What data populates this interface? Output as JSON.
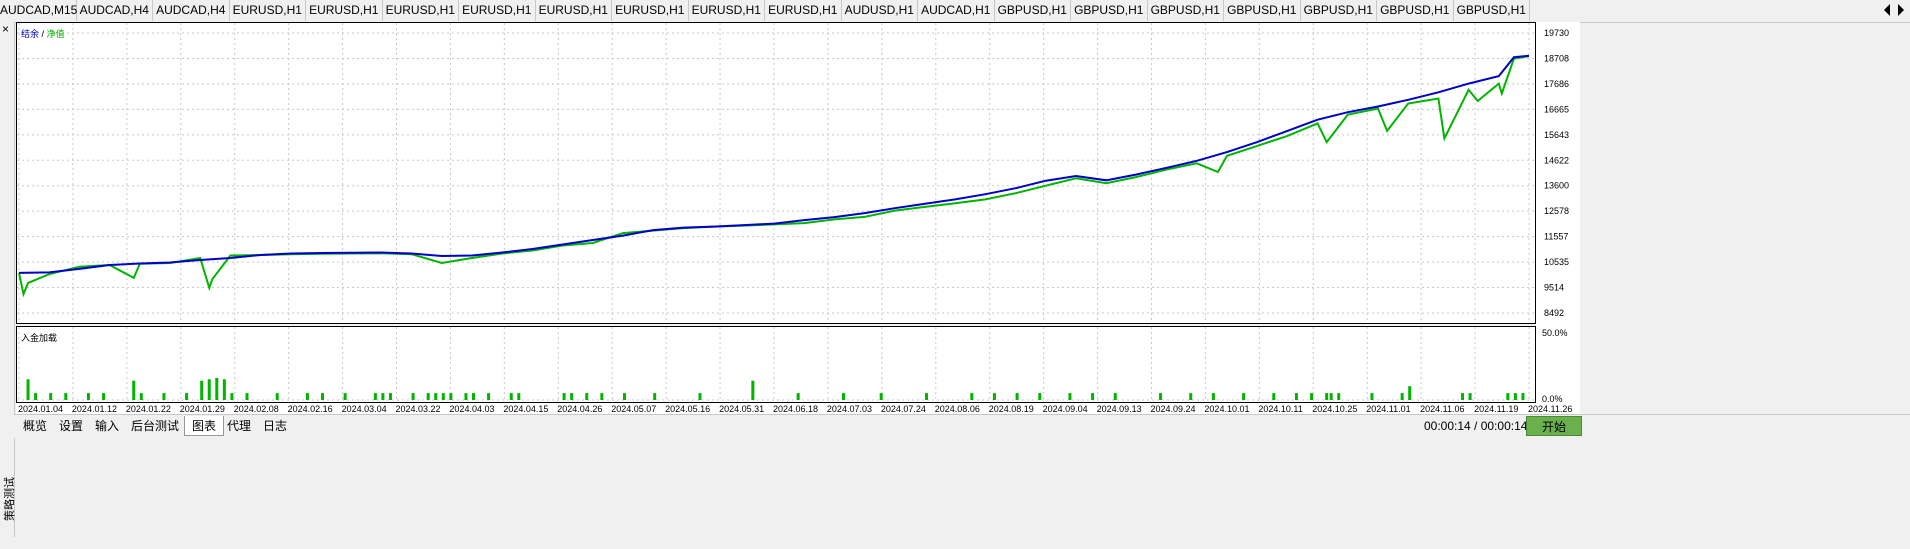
{
  "symbol_tabs": [
    "AUDCAD,M15",
    "AUDCAD,H4",
    "AUDCAD,H4",
    "EURUSD,H1",
    "EURUSD,H1",
    "EURUSD,H1",
    "EURUSD,H1",
    "EURUSD,H1",
    "EURUSD,H1",
    "EURUSD,H1",
    "EURUSD,H1",
    "AUDUSD,H1",
    "AUDCAD,H1",
    "GBPUSD,H1",
    "GBPUSD,H1",
    "GBPUSD,H1",
    "GBPUSD,H1",
    "GBPUSD,H1",
    "GBPUSD,H1",
    "GBPUSD,H1"
  ],
  "side_panel_title": "策略测试",
  "close_symbol": "×",
  "main_legend": {
    "balance": "结余",
    "separator": "/",
    "equity": "净值"
  },
  "sub_legend": "入金加载",
  "bottom_tabs": [
    "概览",
    "设置",
    "输入",
    "后台测试",
    "图表",
    "代理",
    "日志"
  ],
  "active_tab": "图表",
  "timer": "00:00:14 / 00:00:14",
  "start_button": "开始",
  "colors": {
    "balance": "#0000c8",
    "equity": "#00b400",
    "bars": "#00b400"
  },
  "chart_data": [
    {
      "type": "line",
      "series": [
        {
          "name": "结余",
          "color": "#0000c8",
          "x": [
            0,
            2,
            4,
            6,
            8,
            10,
            12,
            14,
            16,
            18,
            20,
            22,
            24,
            26,
            28,
            30,
            32,
            34,
            36,
            38,
            40,
            42,
            44,
            46,
            48,
            50,
            52,
            54,
            56,
            58,
            60,
            62,
            64,
            66,
            68,
            70,
            72,
            74,
            76,
            78,
            80,
            82,
            84,
            86,
            88,
            90,
            92,
            94,
            96,
            98,
            99,
            100
          ],
          "y": [
            10100,
            10120,
            10260,
            10420,
            10480,
            10520,
            10620,
            10700,
            10820,
            10880,
            10900,
            10910,
            10920,
            10880,
            10780,
            10800,
            10920,
            11060,
            11240,
            11420,
            11600,
            11820,
            11920,
            11960,
            12020,
            12080,
            12220,
            12340,
            12500,
            12700,
            12880,
            13050,
            13260,
            13500,
            13800,
            13990,
            13820,
            14050,
            14320,
            14600,
            14950,
            15350,
            15800,
            16250,
            16550,
            16780,
            17050,
            17350,
            17700,
            18000,
            18760,
            18820
          ]
        },
        {
          "name": "净值",
          "color": "#00b400",
          "x": [
            0,
            0.3,
            0.6,
            2,
            4,
            6,
            7.6,
            8,
            10,
            12,
            12.6,
            12.8,
            14,
            16,
            18,
            20,
            22,
            24,
            26,
            28,
            30,
            32,
            34,
            36,
            38,
            40,
            42,
            44,
            46,
            48,
            50,
            52,
            54,
            56,
            58,
            60,
            62,
            64,
            66,
            68,
            70,
            72,
            74,
            76,
            78,
            79.4,
            80,
            82,
            84,
            86,
            86.6,
            88,
            90,
            90.6,
            92,
            94,
            94.4,
            96,
            96.6,
            98,
            98.2,
            99,
            100
          ],
          "y": [
            10100,
            9250,
            9700,
            10050,
            10350,
            10420,
            9900,
            10470,
            10500,
            10700,
            9500,
            9850,
            10800,
            10820,
            10850,
            10870,
            10880,
            10890,
            10850,
            10500,
            10700,
            10880,
            11000,
            11200,
            11300,
            11700,
            11800,
            11900,
            11960,
            12000,
            12050,
            12100,
            12250,
            12350,
            12600,
            12750,
            12900,
            13050,
            13300,
            13600,
            13900,
            13700,
            13950,
            14250,
            14500,
            14150,
            14800,
            15200,
            15600,
            16100,
            15350,
            16450,
            16700,
            15800,
            16900,
            17100,
            15500,
            17450,
            17000,
            17700,
            17300,
            18700,
            18800
          ]
        }
      ],
      "ylim": [
        8492,
        19730
      ],
      "yticks": [
        "19730",
        "18708",
        "17686",
        "16665",
        "15643",
        "14622",
        "13600",
        "12578",
        "11557",
        "10535",
        "9514",
        "8492"
      ]
    },
    {
      "type": "bar",
      "series": [
        {
          "name": "入金加载",
          "color": "#00b400",
          "x": [
            0.5,
            1,
            2,
            3,
            4.5,
            5.5,
            7.5,
            8,
            9.5,
            11,
            12,
            12.5,
            13,
            13.5,
            14,
            15,
            17,
            19,
            20,
            21.5,
            23.5,
            24,
            24.5,
            26,
            27,
            27.5,
            28,
            28.5,
            29.5,
            30,
            31,
            32.5,
            33,
            36,
            36.5,
            37.5,
            38.5,
            40,
            42,
            45,
            48.5,
            51.5,
            54.5,
            57,
            60,
            63,
            64.5,
            66,
            67.5,
            69.5,
            71,
            72.5,
            75.5,
            77.5,
            79,
            81,
            83,
            84.5,
            85.5,
            86.5,
            86.8,
            87.3,
            89.5,
            91.5,
            92,
            95.5,
            96,
            98.5,
            99,
            99.5
          ],
          "values": [
            15,
            5,
            5,
            5,
            5,
            5,
            14,
            5,
            5,
            5,
            14,
            15,
            16,
            15,
            5,
            5,
            5,
            5,
            5,
            5,
            5,
            5,
            5,
            5,
            5,
            5,
            5,
            5,
            5,
            5,
            5,
            5,
            5,
            5,
            5,
            5,
            5,
            5,
            5,
            5,
            14,
            5,
            5,
            5,
            5,
            5,
            5,
            5,
            5,
            5,
            5,
            5,
            5,
            5,
            5,
            5,
            5,
            5,
            5,
            5,
            5,
            5,
            5,
            5,
            10,
            5,
            5,
            5,
            5,
            5
          ]
        }
      ],
      "ylim": [
        0,
        50
      ],
      "yticks": [
        "50.0%",
        "0.0%"
      ]
    }
  ],
  "date_ticks": [
    "2024.01.04",
    "2024.01.12",
    "2024.01.22",
    "2024.01.29",
    "2024.02.08",
    "2024.02.16",
    "2024.03.04",
    "2024.03.22",
    "2024.04.03",
    "2024.04.15",
    "2024.04.26",
    "2024.05.07",
    "2024.05.16",
    "2024.05.31",
    "2024.06.18",
    "2024.07.03",
    "2024.07.24",
    "2024.08.06",
    "2024.08.19",
    "2024.09.04",
    "2024.09.13",
    "2024.09.24",
    "2024.10.01",
    "2024.10.11",
    "2024.10.25",
    "2024.11.01",
    "2024.11.06",
    "2024.11.19",
    "2024.11.26"
  ]
}
